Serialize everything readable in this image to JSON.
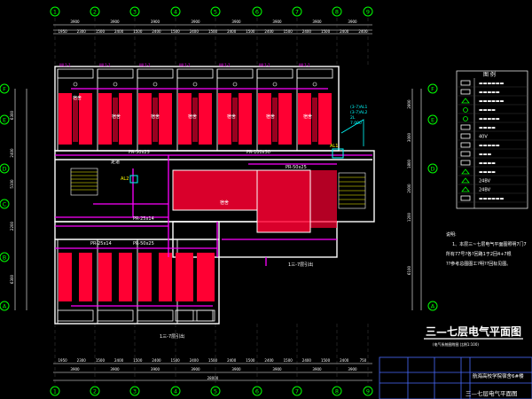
{
  "colors": {
    "background": "#000000",
    "grid_bubble": "#00ff00",
    "dimension": "#ffffff",
    "wall": "#ffffff",
    "room_fill": "#ff0033",
    "circuit": "#ff00ff",
    "label": "#ffff00",
    "cyan": "#00ffff",
    "title_block": "#4a6cff"
  },
  "top_axes": [
    "1",
    "2",
    "3",
    "4",
    "5",
    "6",
    "7",
    "8",
    "9"
  ],
  "bottom_axes": [
    "1",
    "2",
    "3",
    "4",
    "5",
    "6",
    "7",
    "8",
    "9"
  ],
  "left_axes": [
    "F",
    "E",
    "D",
    "C",
    "B",
    "A"
  ],
  "right_axes": [
    "F",
    "E",
    "D",
    "A"
  ],
  "top_dims_row1": [
    "3900",
    "3900",
    "3900",
    "3900",
    "3900",
    "3900",
    "3900",
    "3900"
  ],
  "top_dims_row2": [
    "1950",
    "2300",
    "1500",
    "2400",
    "1500",
    "2400",
    "1500",
    "2400",
    "1500",
    "2400",
    "1500",
    "2400",
    "1500",
    "2400",
    "1500",
    "2400",
    "2400"
  ],
  "bottom_dims_row1": [
    "1950",
    "2300",
    "1500",
    "2400",
    "1500",
    "2400",
    "1500",
    "2400",
    "1500",
    "2400",
    "1500",
    "2400",
    "1500",
    "2400",
    "1500",
    "2400",
    "750"
  ],
  "bottom_dims_row2": [
    "3900",
    "3900",
    "3900",
    "3900",
    "3900",
    "3900",
    "3900",
    "3900"
  ],
  "bottom_total": "28000",
  "left_dims": [
    "6300",
    "2400",
    "5100",
    "2200",
    "6300"
  ],
  "right_dims": [
    "2800",
    "3000",
    "1800",
    "2000",
    "1200",
    "6100"
  ],
  "room_labels": {
    "dorm": "宿舍",
    "corridor": "走道",
    "toilet": "卫生间"
  },
  "circuit_labels": {
    "pr_top_left": "PR-50x25",
    "pr_top_mid": "PR-100x50",
    "pr_right": "PR-50x25",
    "pr_mid": "PR-25x14",
    "pr_low_left": "PR-25x14",
    "pr_low_mid": "PR-50x25"
  },
  "top_room_tag": "WL1-1",
  "box_labels": {
    "al1": "AL1",
    "al2": "AL2"
  },
  "section_notes": {
    "upper": "1三-7层引出",
    "lower": "1三-7层引出"
  },
  "cyan_panel_lines": [
    "(3-7)AL1",
    "(3-7)AL2",
    "2L",
    "7.000"
  ],
  "legend": {
    "title": "图  例",
    "rows": [
      {
        "icon": "panel-box",
        "text": "▬▬▬▬▬▬"
      },
      {
        "icon": "double-box",
        "text": "▬▬▬▬▬"
      },
      {
        "icon": "triangle-double",
        "text": "▬▬▬▬▬▬"
      },
      {
        "icon": "light-circle",
        "text": "▬▬▬▬"
      },
      {
        "icon": "light-circle",
        "text": "▬▬▬▬▬"
      },
      {
        "icon": "exit-light",
        "text": "▬▬▬▬"
      },
      {
        "icon": "socket",
        "text": "40V"
      },
      {
        "icon": "switch",
        "text": "▬▬▬▬▬"
      },
      {
        "icon": "square-mark",
        "text": "▬▬▬"
      },
      {
        "icon": "down-arrow",
        "text": "▬▬▬▬"
      },
      {
        "icon": "triangle-mark",
        "text": "▬▬▬▬"
      },
      {
        "icon": "triangle-mark",
        "text": "24BV"
      },
      {
        "icon": "triangle-mark",
        "text": "24BV"
      },
      {
        "icon": "socket-long",
        "text": "▬▬▬▬▬▬"
      }
    ]
  },
  "notes": {
    "heading": "说明:",
    "lines": [
      "1、本层三~七层电气平面图照明7门7",
      "所有77号?各?回路1于2回4+7根",
      "??参考总图图工?明??回标见图。"
    ]
  },
  "drawing_title": "三—七层电气平面图",
  "drawing_subtitle": "(电气系统图附图 比例1:100)",
  "title_block": {
    "project": "航海高校学院宿舍6#楼",
    "sheet_title": "三—七层电气平面图"
  }
}
